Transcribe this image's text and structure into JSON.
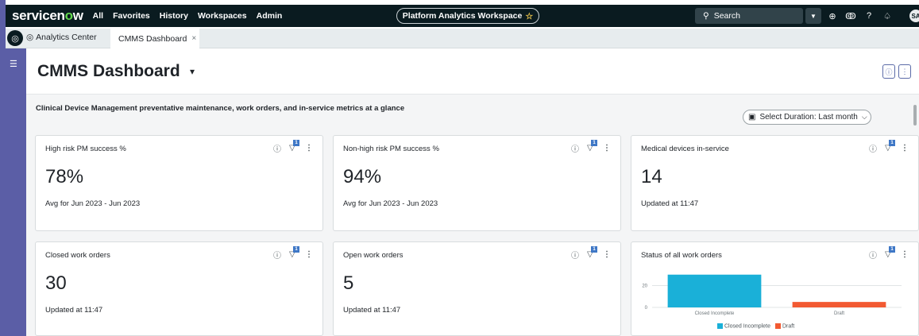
{
  "topnav": {
    "logo_text": "servicen",
    "logo_o": "o",
    "logo_tail": "w",
    "links": [
      "All",
      "Favorites",
      "History",
      "Workspaces",
      "Admin"
    ],
    "workspace": "Platform Analytics Workspace",
    "search_placeholder": "Search",
    "avatar": "SA"
  },
  "tabs": {
    "tab1_label": "Analytics Center",
    "tab2_label": "CMMS Dashboard"
  },
  "page": {
    "title": "CMMS Dashboard",
    "description": "Clinical Device Management preventative maintenance, work orders, and in-service metrics at a glance",
    "duration_label": "Select Duration: Last month"
  },
  "cards": [
    {
      "title": "High risk PM success %",
      "value": "78%",
      "sub": "Avg for Jun 2023 - Jun 2023",
      "filter_count": "1"
    },
    {
      "title": "Non-high risk PM success %",
      "value": "94%",
      "sub": "Avg for Jun 2023 - Jun 2023",
      "filter_count": "1"
    },
    {
      "title": "Medical devices in-service",
      "value": "14",
      "sub": "Updated at 11:47",
      "filter_count": "1"
    },
    {
      "title": "Closed work orders",
      "value": "30",
      "sub": "Updated at 11:47",
      "filter_count": "1"
    },
    {
      "title": "Open work orders",
      "value": "5",
      "sub": "Updated at 11:47",
      "filter_count": "1"
    },
    {
      "title": "Status of all work orders",
      "filter_count": "1"
    }
  ],
  "chart_data": {
    "type": "bar",
    "categories": [
      "Closed Incomplete",
      "Draft"
    ],
    "values": [
      30,
      5
    ],
    "colors": [
      "#1ab0d8",
      "#f25a32"
    ],
    "yticks": [
      0,
      20
    ],
    "ylim": [
      0,
      32
    ],
    "legend": [
      "Closed Incomplete",
      "Draft"
    ],
    "legend_position": "bottom"
  },
  "colors": {
    "nav_bg": "#0a1b20",
    "side_accent": "#5b5ea6",
    "logo_green": "#62d84e",
    "filter_badge": "#3e77c6"
  }
}
